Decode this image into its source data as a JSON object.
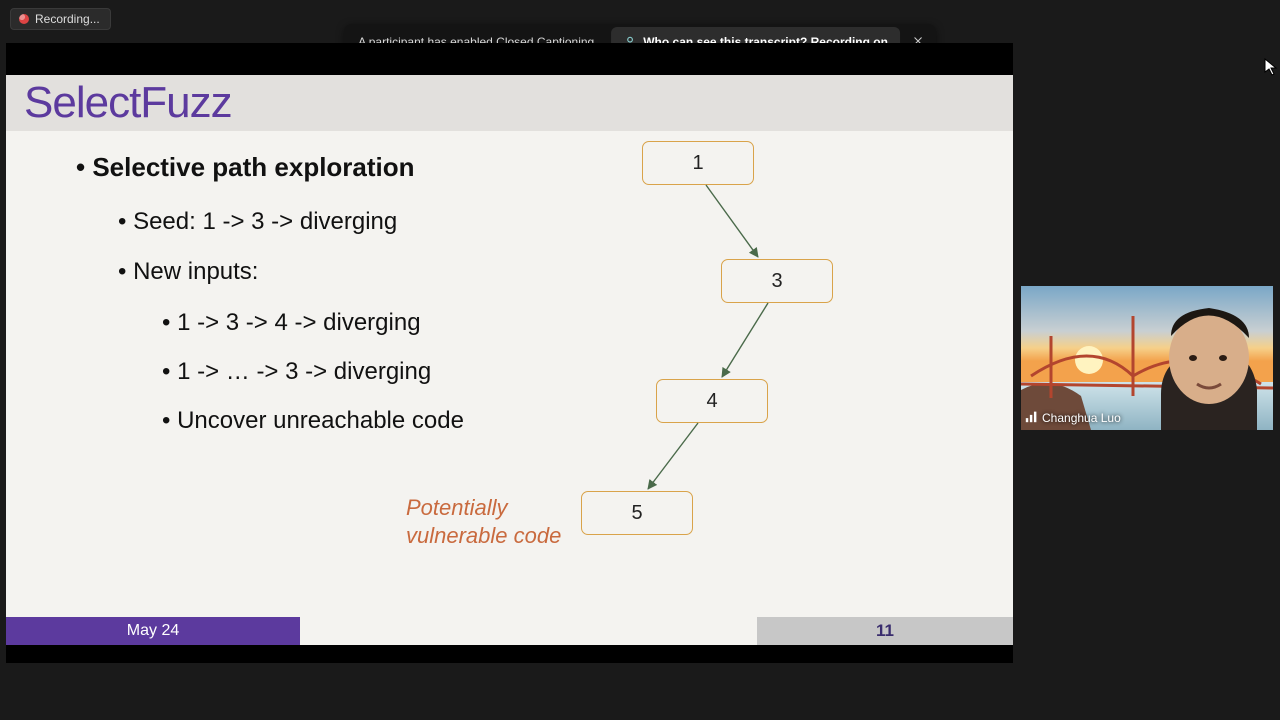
{
  "recording": {
    "label": "Recording..."
  },
  "notification": {
    "message": "A participant has enabled Closed Captioning",
    "pill_text": "Who can see this transcript? Recording on"
  },
  "slide": {
    "title": "SelectFuzz",
    "bullets": {
      "h1": "Selective path exploration",
      "seed": "Seed: 1 -> 3 -> diverging",
      "new_inputs": "New inputs:",
      "i1": "1 -> 3 -> 4 -> diverging",
      "i2": "1 -> … -> 3 -> diverging",
      "i3": "Uncover unreachable code"
    },
    "note_line1": "Potentially",
    "note_line2": "vulnerable code",
    "nodes": {
      "n1": "1",
      "n3": "3",
      "n4": "4",
      "n5": "5"
    },
    "footer_date": "May 24",
    "footer_page": "11"
  },
  "webcam": {
    "name": "Changhua Luo"
  }
}
